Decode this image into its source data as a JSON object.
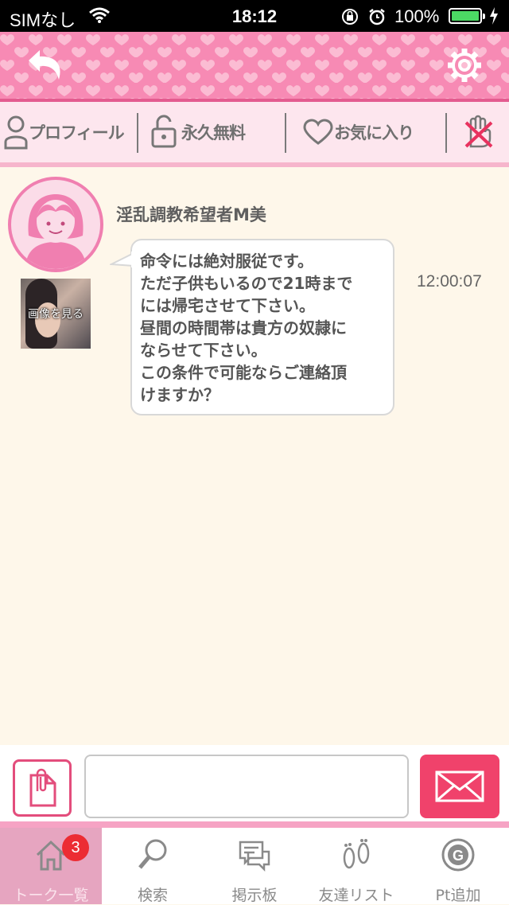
{
  "status_bar": {
    "carrier": "SIMなし",
    "time": "18:12",
    "battery": "100%"
  },
  "header": {
    "back_icon": "back-arrow-icon",
    "settings_icon": "gear-icon"
  },
  "actionbar": {
    "profile_label": "プロフィール",
    "unlock_label": "永久無料",
    "favorite_label": "お気に入り",
    "block_icon": "block-hand-icon"
  },
  "message": {
    "sender": "淫乱調教希望者M美",
    "image_label": "画像を見る",
    "text": " 命令には絶対服従です。\nただ子供もいるので21時まで\nには帰宅させて下さい。\n昼間の時間帯は貴方の奴隷に\nならせて下さい。\nこの条件で可能ならご連絡頂\nけますか？",
    "time": "12:00:07"
  },
  "composer": {
    "input_value": "",
    "attach_icon": "attachment-icon",
    "send_icon": "envelope-icon"
  },
  "tabs": [
    {
      "label": "トーク一覧",
      "icon": "home-icon",
      "badge": "3",
      "active": true
    },
    {
      "label": "検索",
      "icon": "search-icon"
    },
    {
      "label": "掲示板",
      "icon": "board-icon"
    },
    {
      "label": "友達リスト",
      "icon": "footprints-icon"
    },
    {
      "label": "Pt追加",
      "icon": "points-icon"
    }
  ],
  "colors": {
    "header": "#f78ab4",
    "accent": "#f0426b",
    "background": "#fef7ea"
  }
}
